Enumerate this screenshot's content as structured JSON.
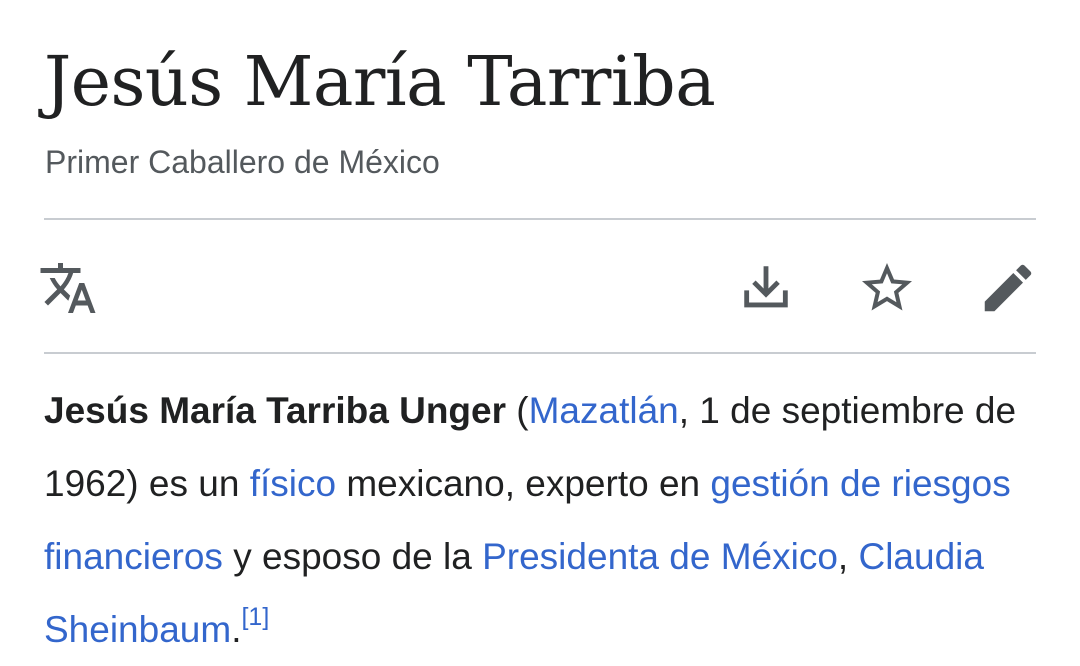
{
  "article": {
    "title": "Jesús María Tarriba",
    "subtitle": "Primer Caballero de México"
  },
  "toolbar": {
    "language_icon": "translate-icon",
    "download_icon": "download-icon",
    "watch_icon": "star-icon",
    "edit_icon": "pencil-icon"
  },
  "lead": {
    "subject_bold": "Jesús María Tarriba Unger",
    "open_paren": " (",
    "birthplace_link": "Mazatlán",
    "birth_date_text": ", 1 de septiembre de 1962) es un ",
    "profession_link": "físico",
    "after_profession": " mexicano, experto en ",
    "expertise_link": "gestión de riesgos financieros",
    "after_expertise": " y esposo de la ",
    "office_link": "Presidenta de México",
    "comma": ", ",
    "spouse_link": "Claudia Sheinbaum",
    "period": ".",
    "reference": "[1]"
  },
  "colors": {
    "text": "#202122",
    "subtitle": "#54595d",
    "link": "#3366cc",
    "icon": "#54595d",
    "divider": "#c8ccd1"
  }
}
